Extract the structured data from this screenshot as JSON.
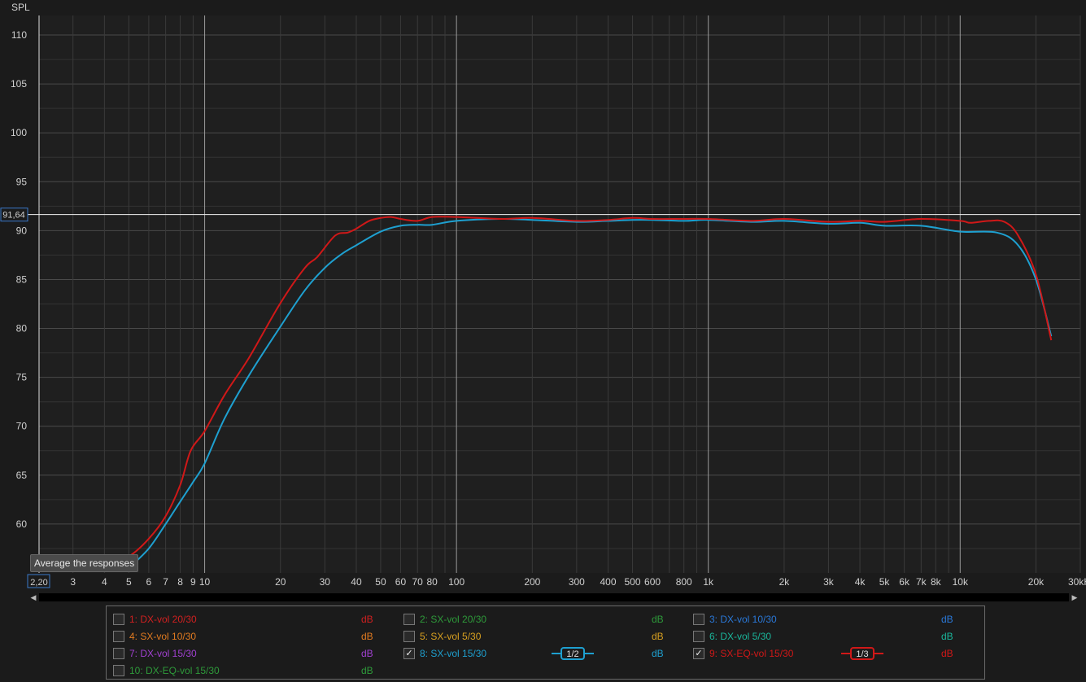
{
  "chart_data": {
    "type": "line",
    "ylabel": "SPL",
    "xscale": "log",
    "xlim": [
      2.2,
      30000
    ],
    "ylim": [
      55,
      112
    ],
    "y_ticks": [
      60,
      65,
      70,
      75,
      80,
      85,
      90,
      95,
      100,
      105,
      110
    ],
    "x_ticks": [
      {
        "v": 3,
        "l": "3"
      },
      {
        "v": 4,
        "l": "4"
      },
      {
        "v": 5,
        "l": "5"
      },
      {
        "v": 6,
        "l": "6"
      },
      {
        "v": 7,
        "l": "7"
      },
      {
        "v": 8,
        "l": "8"
      },
      {
        "v": 9,
        "l": "9"
      },
      {
        "v": 10,
        "l": "10"
      },
      {
        "v": 20,
        "l": "20"
      },
      {
        "v": 30,
        "l": "30"
      },
      {
        "v": 40,
        "l": "40"
      },
      {
        "v": 50,
        "l": "50"
      },
      {
        "v": 60,
        "l": "60"
      },
      {
        "v": 70,
        "l": "70"
      },
      {
        "v": 80,
        "l": "80"
      },
      {
        "v": 100,
        "l": "100"
      },
      {
        "v": 200,
        "l": "200"
      },
      {
        "v": 300,
        "l": "300"
      },
      {
        "v": 400,
        "l": "400"
      },
      {
        "v": 500,
        "l": "500"
      },
      {
        "v": 600,
        "l": "600"
      },
      {
        "v": 800,
        "l": "800"
      },
      {
        "v": 1000,
        "l": "1k"
      },
      {
        "v": 2000,
        "l": "2k"
      },
      {
        "v": 3000,
        "l": "3k"
      },
      {
        "v": 4000,
        "l": "4k"
      },
      {
        "v": 5000,
        "l": "5k"
      },
      {
        "v": 6000,
        "l": "6k"
      },
      {
        "v": 7000,
        "l": "7k"
      },
      {
        "v": 8000,
        "l": "8k"
      },
      {
        "v": 10000,
        "l": "10k"
      },
      {
        "v": 20000,
        "l": "20k"
      },
      {
        "v": 30000,
        "l": "30kHz"
      }
    ],
    "cursor": {
      "y": 91.64,
      "y_label": "91,64",
      "x_label": "2,20"
    },
    "grid": true,
    "series": [
      {
        "name": "8: SX-vol 15/30",
        "color": "#1ea0d0",
        "x": [
          5,
          6,
          7,
          8,
          9,
          10,
          12,
          15,
          20,
          25,
          30,
          35,
          40,
          50,
          60,
          70,
          80,
          100,
          150,
          200,
          300,
          400,
          500,
          600,
          800,
          1000,
          1500,
          2000,
          3000,
          4000,
          5000,
          7000,
          10000,
          14000,
          17000,
          20000,
          23000
        ],
        "y": [
          55.5,
          57.5,
          60.0,
          62.3,
          64.3,
          66.2,
          70.8,
          75.2,
          80.2,
          83.9,
          86.2,
          87.6,
          88.5,
          89.9,
          90.5,
          90.6,
          90.6,
          91.0,
          91.2,
          91.1,
          90.9,
          91.0,
          91.1,
          91.1,
          91.0,
          91.1,
          90.9,
          91.0,
          90.7,
          90.8,
          90.5,
          90.5,
          89.9,
          89.8,
          88.5,
          85.0,
          79.2
        ]
      },
      {
        "name": "9: SX-EQ-vol 15/30",
        "color": "#d01818",
        "x": [
          4,
          5,
          6,
          7,
          8,
          8.8,
          10,
          12,
          15,
          20,
          25,
          28,
          33,
          37,
          40,
          45,
          50,
          55,
          60,
          70,
          80,
          100,
          150,
          200,
          300,
          400,
          500,
          600,
          800,
          1000,
          1500,
          2000,
          3000,
          4000,
          5000,
          7000,
          10000,
          11000,
          13000,
          15000,
          17000,
          20000,
          23000
        ],
        "y": [
          55.8,
          56.7,
          58.5,
          60.8,
          64.0,
          67.5,
          69.5,
          73.2,
          77.0,
          82.6,
          86.2,
          87.3,
          89.5,
          89.8,
          90.2,
          91.0,
          91.3,
          91.4,
          91.2,
          91.0,
          91.4,
          91.4,
          91.2,
          91.3,
          91.0,
          91.1,
          91.3,
          91.2,
          91.2,
          91.2,
          91.0,
          91.2,
          90.9,
          91.0,
          90.9,
          91.2,
          91.0,
          90.8,
          91.0,
          90.9,
          89.5,
          85.5,
          78.8
        ]
      }
    ]
  },
  "tooltip": "Average the responses",
  "legend": [
    {
      "label": "1: DX-vol 20/30",
      "unit": "dB",
      "color": "#d02020",
      "checked": false,
      "smoothing": ""
    },
    {
      "label": "2: SX-vol 20/30",
      "unit": "dB",
      "color": "#2e9a3a",
      "checked": false,
      "smoothing": ""
    },
    {
      "label": "3: DX-vol 10/30",
      "unit": "dB",
      "color": "#2a78d8",
      "checked": false,
      "smoothing": ""
    },
    {
      "label": "4: SX-vol 10/30",
      "unit": "dB",
      "color": "#e07a20",
      "checked": false,
      "smoothing": ""
    },
    {
      "label": "5: SX-vol 5/30",
      "unit": "dB",
      "color": "#d8a020",
      "checked": false,
      "smoothing": ""
    },
    {
      "label": "6: DX-vol 5/30",
      "unit": "dB",
      "color": "#1ab59a",
      "checked": false,
      "smoothing": ""
    },
    {
      "label": "7: DX-vol 15/30",
      "unit": "dB",
      "color": "#a040d0",
      "checked": false,
      "smoothing": ""
    },
    {
      "label": "8: SX-vol 15/30",
      "unit": "dB",
      "color": "#1ea0d0",
      "checked": true,
      "smoothing": "1/2"
    },
    {
      "label": "9: SX-EQ-vol 15/30",
      "unit": "dB",
      "color": "#d01818",
      "checked": true,
      "smoothing": "1/3"
    },
    {
      "label": "10: DX-EQ-vol 15/30",
      "unit": "dB",
      "color": "#2e9a3a",
      "checked": false,
      "smoothing": ""
    }
  ],
  "icons": {
    "scroll_left": "arrow-left-icon",
    "scroll_right": "arrow-right-icon",
    "checkbox": "checkmark-icon"
  }
}
